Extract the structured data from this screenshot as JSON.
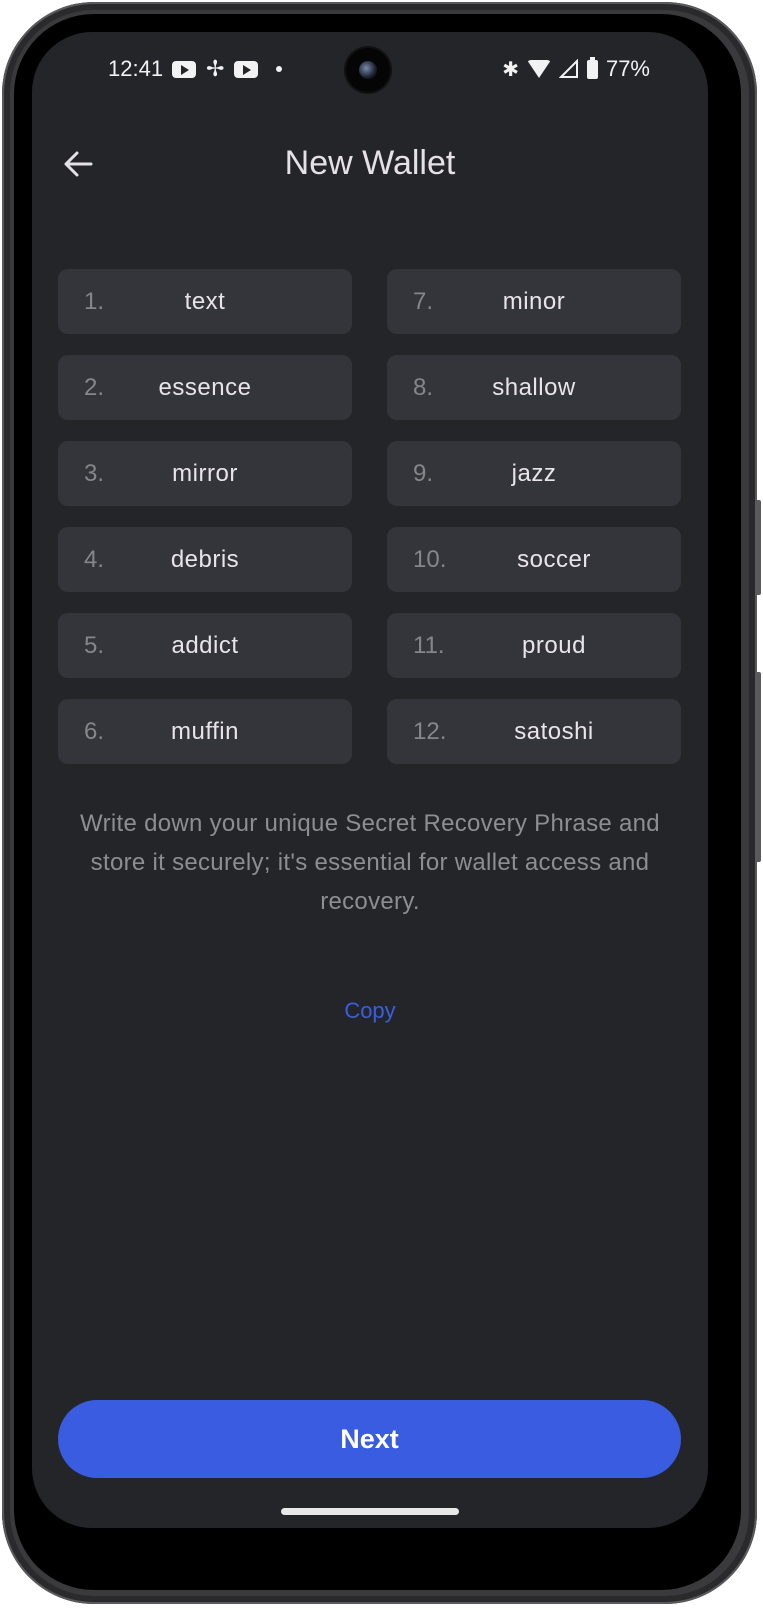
{
  "status_bar": {
    "time": "12:41",
    "left_icons": [
      "youtube-icon",
      "pinwheel-icon",
      "youtube-icon",
      "dot-icon"
    ],
    "right_icons": [
      "bluetooth-icon",
      "wifi-icon",
      "cellular-icon",
      "battery-icon"
    ],
    "battery": "77%"
  },
  "app_bar": {
    "back_icon": "arrow-left-icon",
    "title": "New Wallet"
  },
  "phrase": {
    "words": [
      {
        "index": "1.",
        "word": "text"
      },
      {
        "index": "7.",
        "word": "minor"
      },
      {
        "index": "2.",
        "word": "essence"
      },
      {
        "index": "8.",
        "word": "shallow"
      },
      {
        "index": "3.",
        "word": "mirror"
      },
      {
        "index": "9.",
        "word": "jazz"
      },
      {
        "index": "4.",
        "word": "debris"
      },
      {
        "index": "10.",
        "word": "soccer"
      },
      {
        "index": "5.",
        "word": "addict"
      },
      {
        "index": "11.",
        "word": "proud"
      },
      {
        "index": "6.",
        "word": "muffin"
      },
      {
        "index": "12.",
        "word": "satoshi"
      }
    ]
  },
  "description": "Write down your unique Secret Recovery Phrase and store it securely; it's essential for wallet access and recovery.",
  "copy_label": "Copy",
  "next_label": "Next",
  "colors": {
    "background": "#242529",
    "cell_background": "#34353a",
    "accent": "#395ce0",
    "link": "#3b5ddf"
  }
}
